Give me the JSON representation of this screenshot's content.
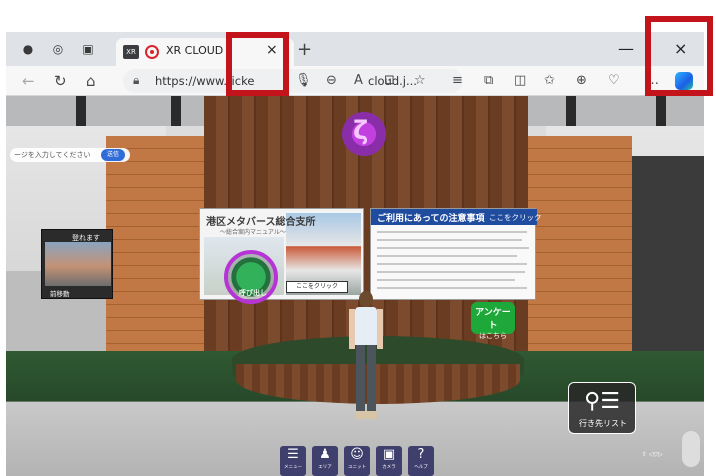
{
  "browser": {
    "tab_title": "XR CLOUD",
    "tab_badge": "XR",
    "tab_close": "×",
    "new_tab": "+",
    "url": "https://www.ticke",
    "url_tail": "cloud.j...",
    "window_close": "×",
    "window_min": "—"
  },
  "scene": {
    "search_placeholder": "ージを入力してください",
    "search_button": "送信",
    "guide_board": {
      "title": "港区メタバース総合支所",
      "subtitle": "～総合案内マニュアル～",
      "button": "ここをクリック"
    },
    "notice_board": {
      "title": "ご利用にあっての注意事項",
      "link": "ここをクリック"
    },
    "left_board": {
      "title": "登れます",
      "caption": "前移動"
    },
    "call_button": "呼び出し",
    "survey": {
      "line1": "アンケート",
      "line2": "はこちら"
    },
    "destination_button": "行き先リスト"
  },
  "toolbar": [
    {
      "icon": "☰",
      "label": "メニュー"
    },
    {
      "icon": "♟",
      "label": "エリア"
    },
    {
      "icon": "☺",
      "label": "ユニット"
    },
    {
      "icon": "▣",
      "label": "カメラ"
    },
    {
      "icon": "?",
      "label": "ヘルプ"
    }
  ],
  "colors": {
    "highlight_box": "#c4141b",
    "notice_header": "#1f4c9f",
    "survey": "#1fa83a",
    "call_ring": "#b634d6"
  }
}
